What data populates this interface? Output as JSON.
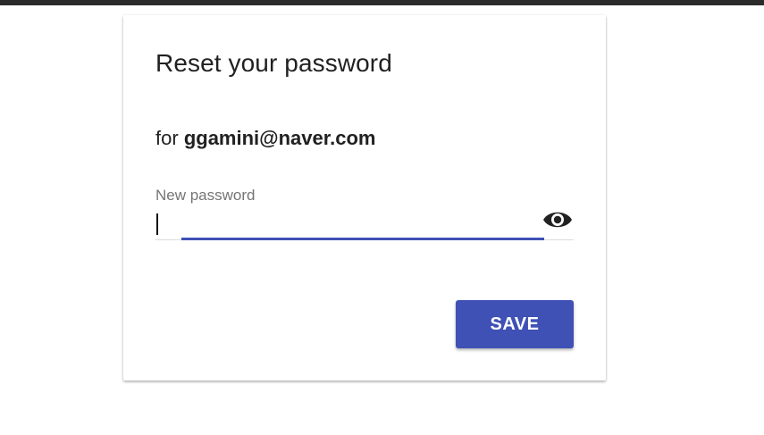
{
  "dialog": {
    "title": "Reset your password",
    "for_prefix": "for",
    "email": "ggamini@naver.com"
  },
  "password_field": {
    "label": "New password",
    "value": "",
    "accent_color": "#3f51b5",
    "toggle_icon": "eye-icon"
  },
  "actions": {
    "save_label": "SAVE",
    "save_color": "#3f51b5"
  }
}
